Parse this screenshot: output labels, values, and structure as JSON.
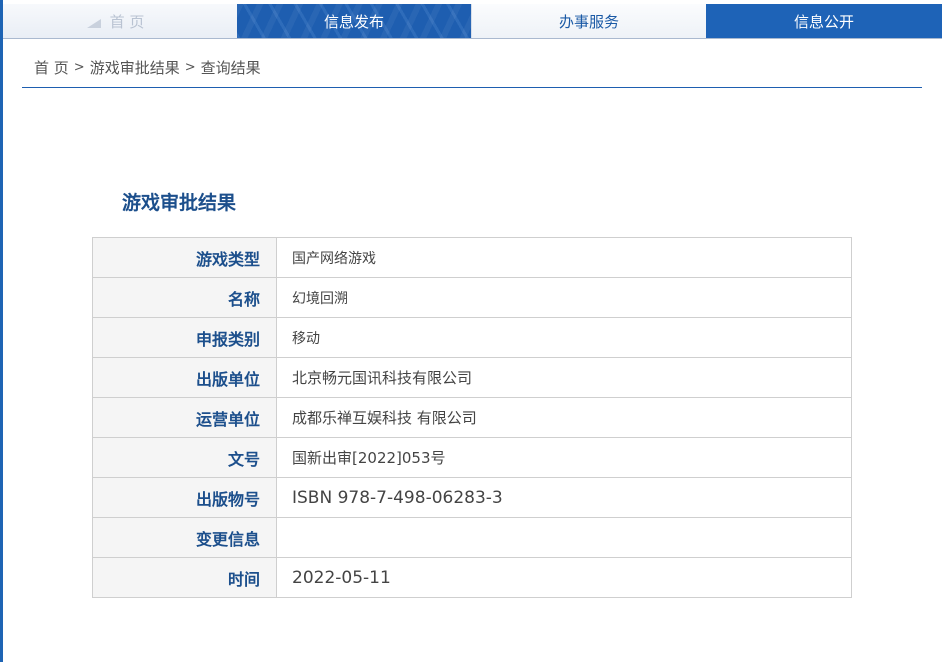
{
  "nav": {
    "tabs": [
      {
        "label": "首 页"
      },
      {
        "label": "信息发布"
      },
      {
        "label": "办事服务"
      },
      {
        "label": "信息公开"
      }
    ]
  },
  "breadcrumb": {
    "items": [
      "首 页",
      "游戏审批结果",
      "查询结果"
    ],
    "separator": ">"
  },
  "result": {
    "title": "游戏审批结果",
    "rows": [
      {
        "label": "游戏类型",
        "value": "国产网络游戏"
      },
      {
        "label": "名称",
        "value": "幻境回溯"
      },
      {
        "label": "申报类别",
        "value": "移动"
      },
      {
        "label": "出版单位",
        "value": "北京畅元国讯科技有限公司"
      },
      {
        "label": "运营单位",
        "value": "成都乐禅互娱科技 有限公司"
      },
      {
        "label": "文号",
        "value": "国新出审[2022]053号"
      },
      {
        "label": "出版物号",
        "value": "ISBN 978-7-498-06283-3"
      },
      {
        "label": "变更信息",
        "value": ""
      },
      {
        "label": "时间",
        "value": "2022-05-11"
      }
    ]
  },
  "colors": {
    "brand_blue": "#1e5eb0",
    "label_blue": "#1c4f8c"
  }
}
